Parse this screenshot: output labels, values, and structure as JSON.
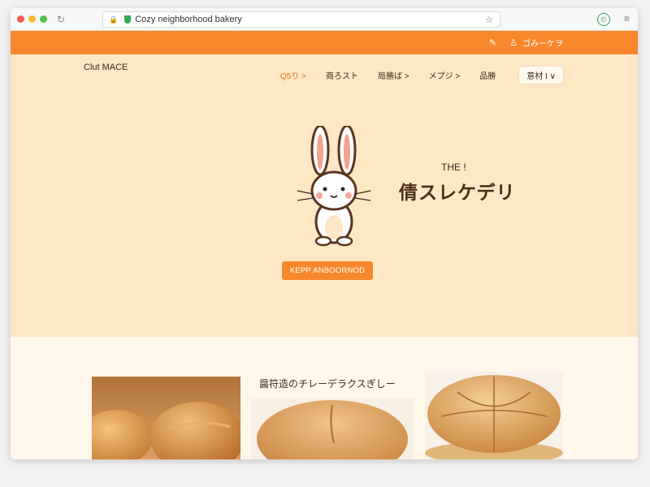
{
  "browser": {
    "url": "Cozy neighborhood bakery"
  },
  "topbar": {
    "account_label": "ゴみーケヲ"
  },
  "header": {
    "logo": "Clut MACE",
    "nav": [
      {
        "label": "Q5り >"
      },
      {
        "label": "商ろスト"
      },
      {
        "label": "局勝ば >"
      },
      {
        "label": "メプジ >"
      },
      {
        "label": "品勝"
      }
    ],
    "lang_button": "意材 I ∨"
  },
  "hero": {
    "subtitle": "THE !",
    "title": "倩スレケデリ",
    "cta": "KEPP ANBOORNOD"
  },
  "section": {
    "heading": "醤符造のチレーデラクスぎしー"
  },
  "colors": {
    "accent": "#f7872b",
    "hero_bg": "#fde7c4",
    "lower_bg": "#fff7ea"
  }
}
